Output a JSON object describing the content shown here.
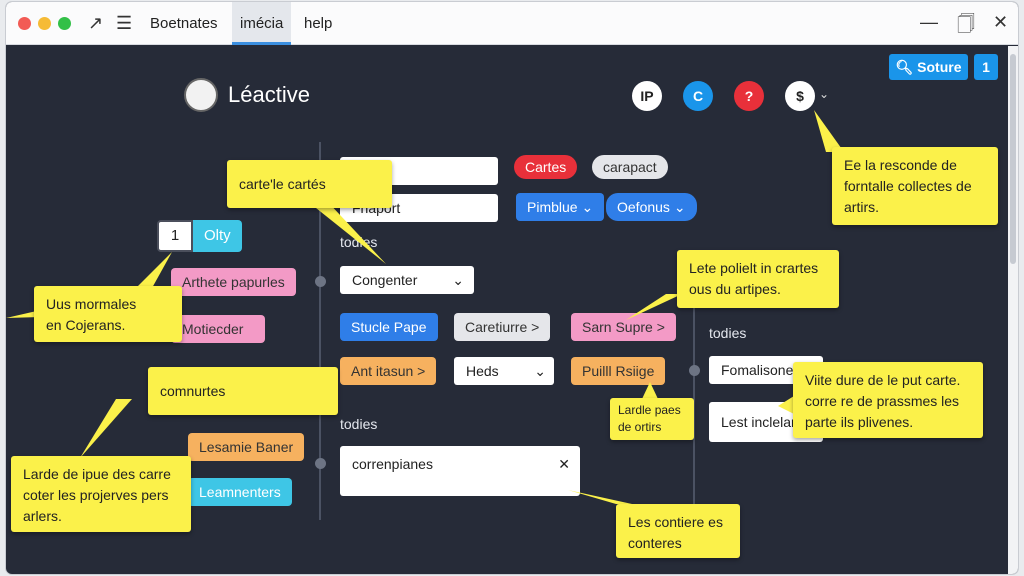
{
  "titlebar": {
    "menus": [
      "Boetnates",
      "imécia",
      "help"
    ],
    "active_menu": "imécia",
    "search_button": "Soture",
    "counter_button": "1"
  },
  "header": {
    "logo_text": "Léactive",
    "avatars": [
      {
        "label": "IP",
        "bg": "#ffffff",
        "fg": "#222222"
      },
      {
        "label": "C",
        "bg": "#1a95ea",
        "fg": "#ffffff"
      },
      {
        "label": "?",
        "bg": "#e8303a",
        "fg": "#ffffff"
      },
      {
        "label": "$",
        "bg": "#ffffff",
        "fg": "#222222"
      }
    ]
  },
  "left": {
    "stepper_value": "1",
    "stepper_chip": "Olty",
    "chips": [
      "Arthete papurles",
      "Motiecder",
      "Lesamie Baner",
      "Leamnenters"
    ]
  },
  "main": {
    "input_1": "s",
    "input_2": "Fhaport",
    "tag_red": "Cartes",
    "tag_gray": "carapact",
    "dropdown_blue_1": "Pimblue",
    "dropdown_blue_2": "Oefonus",
    "section_1": "todies",
    "select_1": "Congenter",
    "row_1": [
      "Stucle Pape",
      "Caretiurre >",
      "Sarn Supre >"
    ],
    "row_2": [
      "Ant itasun >",
      "Heds",
      "Puilll Rsiige"
    ],
    "section_2": "todies",
    "textarea": "correnpianes",
    "right_section": "todies",
    "right_field_1": "Fomalisones",
    "right_field_2": "Lest inclelare"
  },
  "notes": {
    "n1": "carte'le cartés",
    "n2": "Uus mormales\nen Cojerans.",
    "n3": "comnurtes",
    "n4": "Larde de ipue des carre\ncoter les projerves pers\narlers.",
    "n5": "Ee la resconde de\nforntalle collectes de\nartirs.",
    "n6": "Lete polielt in crartes\nous du artipes.",
    "n7": "Lardle paes\nde ortirs",
    "n8": "Viite dure de le put carte.\ncorre re de prassmes les\nparte ils plivenes.",
    "n9": "Les contiere es\nconteres"
  },
  "colors": {
    "background": "#262b38",
    "accent_blue": "#1a95ea",
    "note_yellow": "#fbf14a",
    "chip_pink": "#f39ac6",
    "chip_cyan": "#3ec6e6",
    "chip_orange": "#f6b15f",
    "chip_red": "#e8303a"
  },
  "icons": [
    "close-window-icon",
    "minimize-icon",
    "clipboard-icon",
    "menu-icon",
    "pen-icon",
    "search-icon",
    "chevron-down-icon",
    "clear-icon"
  ]
}
